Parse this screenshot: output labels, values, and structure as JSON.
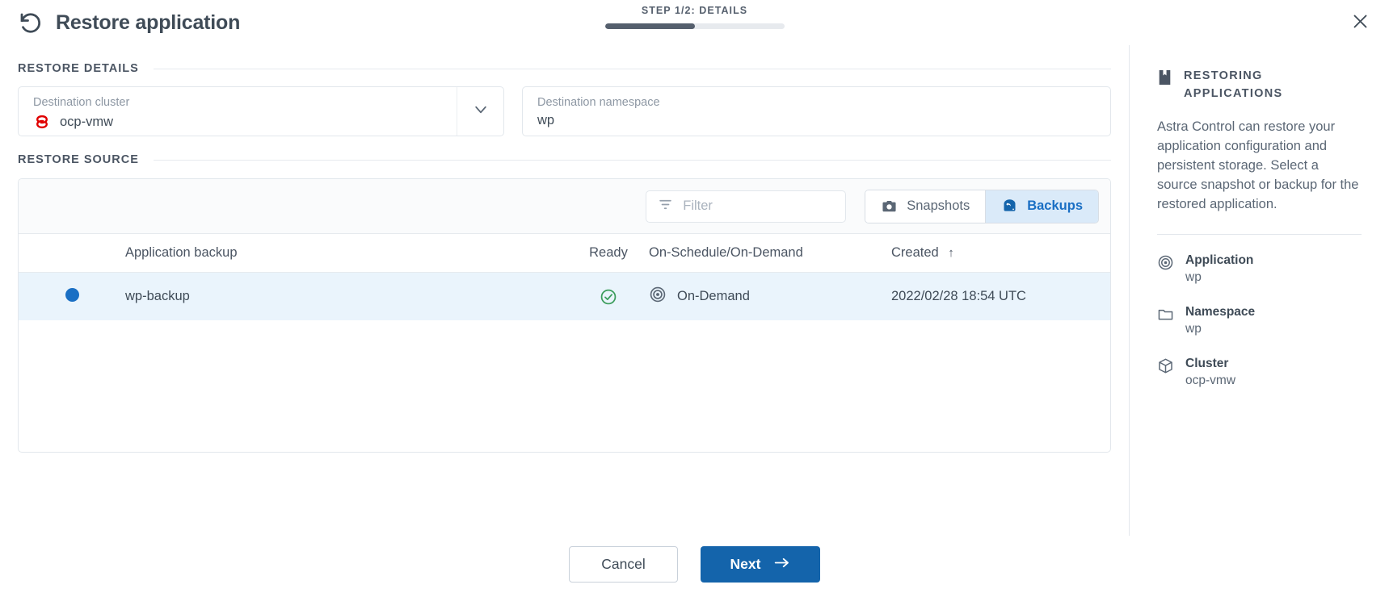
{
  "header": {
    "title": "Restore application",
    "restore_icon": "restore-undo-arrow-icon",
    "step_label": "STEP 1/2: DETAILS",
    "progress_percent": 50,
    "close_icon": "close-icon"
  },
  "sections": {
    "restore_details_label": "RESTORE DETAILS",
    "restore_source_label": "RESTORE SOURCE"
  },
  "fields": {
    "destination_cluster": {
      "label": "Destination cluster",
      "value": "ocp-vmw",
      "icon": "openshift-logo-icon",
      "caret_icon": "chevron-down-icon"
    },
    "destination_namespace": {
      "label": "Destination namespace",
      "value": "wp",
      "placeholder": "Destination namespace"
    }
  },
  "toolbar": {
    "filter_placeholder": "Filter",
    "filter_value": "",
    "filter_icon": "filter-funnel-icon",
    "tabs": [
      {
        "label": "Snapshots",
        "icon": "camera-icon",
        "active": false
      },
      {
        "label": "Backups",
        "icon": "backup-restore-icon",
        "active": true
      }
    ]
  },
  "table": {
    "columns": [
      "Application backup",
      "Ready",
      "On-Schedule/On-Demand",
      "Created"
    ],
    "sort_column": "Created",
    "sort_direction_icon": "↑",
    "rows": [
      {
        "selected": true,
        "radio_icon": "radio-selected-icon",
        "name": "wp-backup",
        "ready_icon": "check-circle-icon",
        "schedule_icon": "target-icon",
        "schedule": "On-Demand",
        "created": "2022/02/28 18:54 UTC"
      }
    ]
  },
  "sidebar": {
    "icon": "book-icon",
    "title": "RESTORING APPLICATIONS",
    "description": "Astra Control can restore your application configuration and persistent storage. Select a source snapshot or backup for the restored application.",
    "meta": [
      {
        "icon": "target-icon",
        "label": "Application",
        "value": "wp"
      },
      {
        "icon": "folder-icon",
        "label": "Namespace",
        "value": "wp"
      },
      {
        "icon": "cube-icon",
        "label": "Cluster",
        "value": "ocp-vmw"
      }
    ]
  },
  "footer": {
    "cancel_label": "Cancel",
    "next_label": "Next",
    "next_icon": "arrow-right-icon"
  },
  "colors": {
    "accent_blue": "#1464ab",
    "tab_active_bg": "#daeaf9",
    "row_selected_bg": "#eaf4fc",
    "ready_green": "#3c9d5c",
    "openshift_red": "#e00000",
    "text_dark": "#3f4b57"
  }
}
